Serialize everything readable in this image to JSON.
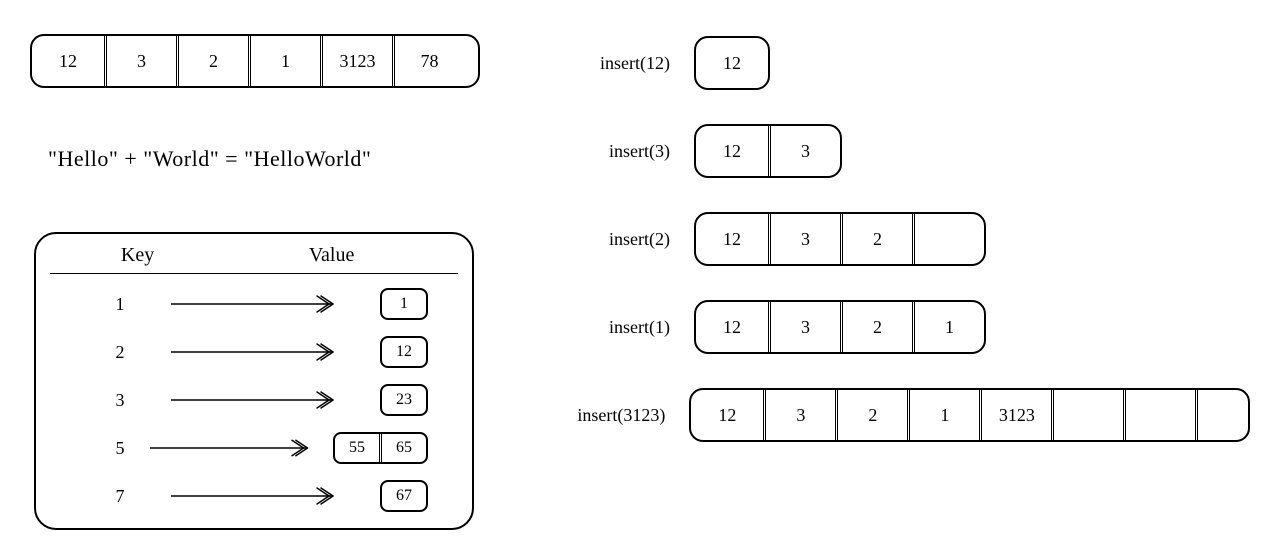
{
  "top_array": [
    "12",
    "3",
    "2",
    "1",
    "3123",
    "78"
  ],
  "string_equation": {
    "lhs1": "\"Hello\"",
    "op1": "+",
    "lhs2": "\"World\"",
    "eq": "=",
    "rhs": "\"HelloWorld\""
  },
  "hash_table": {
    "header_key": "Key",
    "header_value": "Value",
    "rows": [
      {
        "key": "1",
        "values": [
          "1"
        ]
      },
      {
        "key": "2",
        "values": [
          "12"
        ]
      },
      {
        "key": "3",
        "values": [
          "23"
        ]
      },
      {
        "key": "5",
        "values": [
          "55",
          "65"
        ]
      },
      {
        "key": "7",
        "values": [
          "67"
        ]
      }
    ]
  },
  "insert_steps": [
    {
      "label": "insert(12)",
      "cells": [
        "12"
      ],
      "capacity": 1
    },
    {
      "label": "insert(3)",
      "cells": [
        "12",
        "3"
      ],
      "capacity": 2
    },
    {
      "label": "insert(2)",
      "cells": [
        "12",
        "3",
        "2"
      ],
      "capacity": 4
    },
    {
      "label": "insert(1)",
      "cells": [
        "12",
        "3",
        "2",
        "1"
      ],
      "capacity": 4
    },
    {
      "label": "insert(3123)",
      "cells": [
        "12",
        "3",
        "2",
        "1",
        "3123"
      ],
      "capacity": 8
    }
  ]
}
